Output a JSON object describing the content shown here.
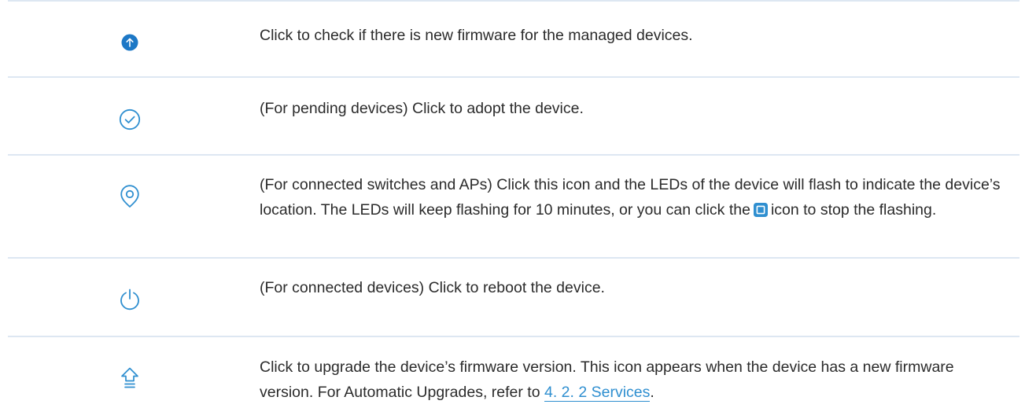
{
  "rows": [
    {
      "icon": "upload-circle-icon",
      "text": "Click to check if there is new firmware for the managed devices."
    },
    {
      "icon": "check-circle-icon",
      "text": "(For pending devices) Click to adopt the device."
    },
    {
      "icon": "location-pin-icon",
      "text_before": "(For connected switches and APs) Click this icon and the LEDs of the device will flash to indicate the device’s location. The LEDs will keep flashing for 10 minutes, or you can click the",
      "inline_icon": "stop-square-icon",
      "text_after": "icon to stop the flashing."
    },
    {
      "icon": "power-icon",
      "text": "(For connected devices) Click to reboot the device."
    },
    {
      "icon": "upgrade-arrow-icon",
      "text_before": "Click to upgrade the device’s firmware version. This icon appears when the device has a new firmware version. For Automatic Upgrades, refer to",
      "link": "4. 2. 2 Services",
      "text_after": "."
    }
  ],
  "colors": {
    "accent": "#2f8fd0",
    "divider": "#dde7f2",
    "text": "#2b2b2b"
  }
}
